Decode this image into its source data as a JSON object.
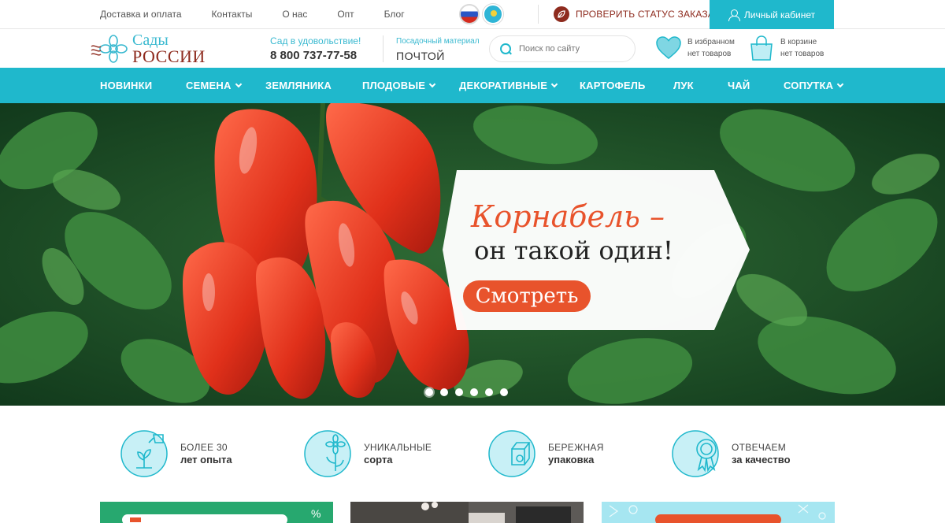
{
  "topbar": {
    "links": [
      "Доставка и оплата",
      "Контакты",
      "О нас",
      "Опт",
      "Блог"
    ],
    "check_status": "ПРОВЕРИТЬ СТАТУС ЗАКАЗА",
    "cabinet": "Личный кабинет"
  },
  "header": {
    "logo_line1": "Сады",
    "logo_line2": "РОССИИ",
    "phone_label": "Сад в удовольствие!",
    "phone": "8 800 737-77-58",
    "mail_label": "Посадочный материал",
    "mail_value": "ПОЧТОЙ",
    "search_placeholder": "Поиск по сайту",
    "favorites_line1": "В избранном",
    "favorites_line2": "нет товаров",
    "cart_line1": "В корзине",
    "cart_line2": "нет товаров"
  },
  "nav": [
    {
      "label": "НОВИНКИ",
      "has_dropdown": false
    },
    {
      "label": "СЕМЕНА",
      "has_dropdown": true
    },
    {
      "label": "ЗЕМЛЯНИКА",
      "has_dropdown": false
    },
    {
      "label": "ПЛОДОВЫЕ",
      "has_dropdown": true
    },
    {
      "label": "ДЕКОРАТИВНЫЕ",
      "has_dropdown": true
    },
    {
      "label": "КАРТОФЕЛЬ",
      "has_dropdown": false
    },
    {
      "label": "ЛУК",
      "has_dropdown": false
    },
    {
      "label": "ЧАЙ",
      "has_dropdown": false
    },
    {
      "label": "СОПУТКА",
      "has_dropdown": true
    }
  ],
  "hero": {
    "title": "Корнабель –",
    "subtitle": "он такой один!",
    "button": "Смотреть",
    "slide_count": 6,
    "active_slide": 1
  },
  "features": [
    {
      "line1": "БОЛЕЕ 30",
      "line2": "лет опыта",
      "icon": "watering-can-sprout-icon"
    },
    {
      "line1": "УНИКАЛЬНЫЕ",
      "line2": "сорта",
      "icon": "flower-icon"
    },
    {
      "line1": "БЕРЕЖНАЯ",
      "line2": "упаковка",
      "icon": "box-icon"
    },
    {
      "line1": "ОТВЕЧАЕМ",
      "line2": "за качество",
      "icon": "award-badge-icon"
    }
  ],
  "colors": {
    "accent": "#1fb8cc",
    "brand_red": "#8e2b1e",
    "cta_orange": "#e8532c"
  }
}
